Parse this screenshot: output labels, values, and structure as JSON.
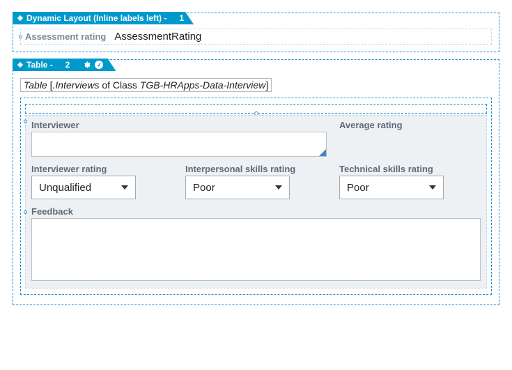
{
  "panel1": {
    "title_prefix": "Dynamic Layout (Inline labels left) -",
    "title_num": "1",
    "field_label": "Assessment rating",
    "field_value": "AssessmentRating"
  },
  "panel2": {
    "title_prefix": "Table -",
    "title_num": "2",
    "table_word": "Table",
    "bracket_open": " [",
    "interviews": ".Interviews",
    "of_class": " of Class ",
    "class_name": "TGB-HRApps-Data-Interview",
    "bracket_close": "]",
    "fields": {
      "interviewer_label": "Interviewer",
      "avg_rating_label": "Average rating",
      "interviewer_rating_label": "Interviewer rating",
      "interpersonal_label": "Interpersonal skills rating",
      "technical_label": "Technical skills rating",
      "feedback_label": "Feedback",
      "interviewer_rating_value": "Unqualified",
      "interpersonal_value": "Poor",
      "technical_value": "Poor"
    }
  }
}
